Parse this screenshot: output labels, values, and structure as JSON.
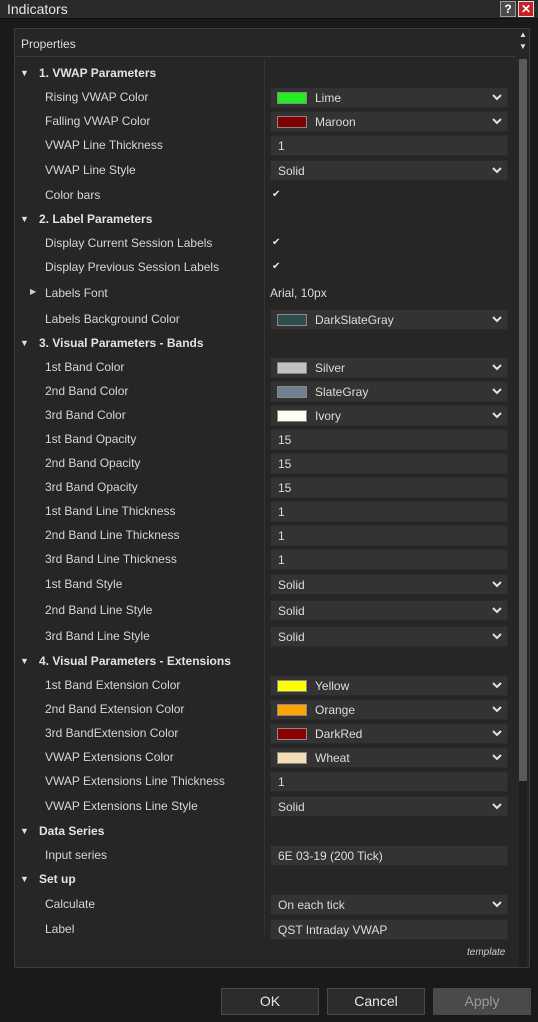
{
  "window": {
    "title": "Indicators",
    "help_glyph": "?",
    "close_glyph": "✕"
  },
  "properties_header": "Properties",
  "categories": {
    "vwap": "1. VWAP Parameters",
    "label": "2. Label Parameters",
    "bands": "3. Visual Parameters - Bands",
    "extensions": "4. Visual Parameters - Extensions",
    "data_series": "Data Series",
    "setup": "Set up"
  },
  "vwap": {
    "rising_label": "Rising VWAP Color",
    "rising_value": "Lime",
    "rising_color": "#22ee22",
    "falling_label": "Falling VWAP Color",
    "falling_value": "Maroon",
    "falling_color": "#800000",
    "thickness_label": "VWAP Line Thickness",
    "thickness_value": "1",
    "style_label": "VWAP Line Style",
    "style_value": "Solid",
    "colorbars_label": "Color bars",
    "colorbars_checked": true
  },
  "labels": {
    "current_label": "Display Current Session Labels",
    "current_checked": true,
    "previous_label": "Display Previous Session Labels",
    "previous_checked": true,
    "font_label": "Labels Font",
    "font_value": "Arial, 10px",
    "bg_label": "Labels Background Color",
    "bg_value": "DarkSlateGray",
    "bg_color": "#2f4f4f"
  },
  "bands": {
    "c1_label": "1st Band Color",
    "c1_value": "Silver",
    "c1_color": "#c0c0c0",
    "c2_label": "2nd Band Color",
    "c2_value": "SlateGray",
    "c2_color": "#708090",
    "c3_label": "3rd Band Color",
    "c3_value": "Ivory",
    "c3_color": "#fffff0",
    "o1_label": "1st Band Opacity",
    "o1_value": "15",
    "o2_label": "2nd Band Opacity",
    "o2_value": "15",
    "o3_label": "3rd Band Opacity",
    "o3_value": "15",
    "t1_label": "1st Band Line Thickness",
    "t1_value": "1",
    "t2_label": "2nd Band Line Thickness",
    "t2_value": "1",
    "t3_label": "3rd Band Line Thickness",
    "t3_value": "1",
    "s1_label": "1st Band Style",
    "s1_value": "Solid",
    "s2_label": "2nd Band Line Style",
    "s2_value": "Solid",
    "s3_label": "3rd Band Line Style",
    "s3_value": "Solid"
  },
  "extensions": {
    "e1_label": "1st Band Extension Color",
    "e1_value": "Yellow",
    "e1_color": "#ffff00",
    "e2_label": "2nd Band Extension Color",
    "e2_value": "Orange",
    "e2_color": "#ffa500",
    "e3_label": "3rd BandExtension Color",
    "e3_value": "DarkRed",
    "e3_color": "#8b0000",
    "vc_label": "VWAP Extensions Color",
    "vc_value": "Wheat",
    "vc_color": "#f5deb3",
    "vt_label": "VWAP Extensions Line Thickness",
    "vt_value": "1",
    "vs_label": "VWAP Extensions Line Style",
    "vs_value": "Solid"
  },
  "data_series": {
    "input_label": "Input series",
    "input_value": "6E 03-19 (200 Tick)"
  },
  "setup": {
    "calc_label": "Calculate",
    "calc_value": "On each tick",
    "label_label": "Label",
    "label_value": "QST Intraday VWAP"
  },
  "template_link": "template",
  "buttons": {
    "ok": "OK",
    "cancel": "Cancel",
    "apply": "Apply"
  }
}
